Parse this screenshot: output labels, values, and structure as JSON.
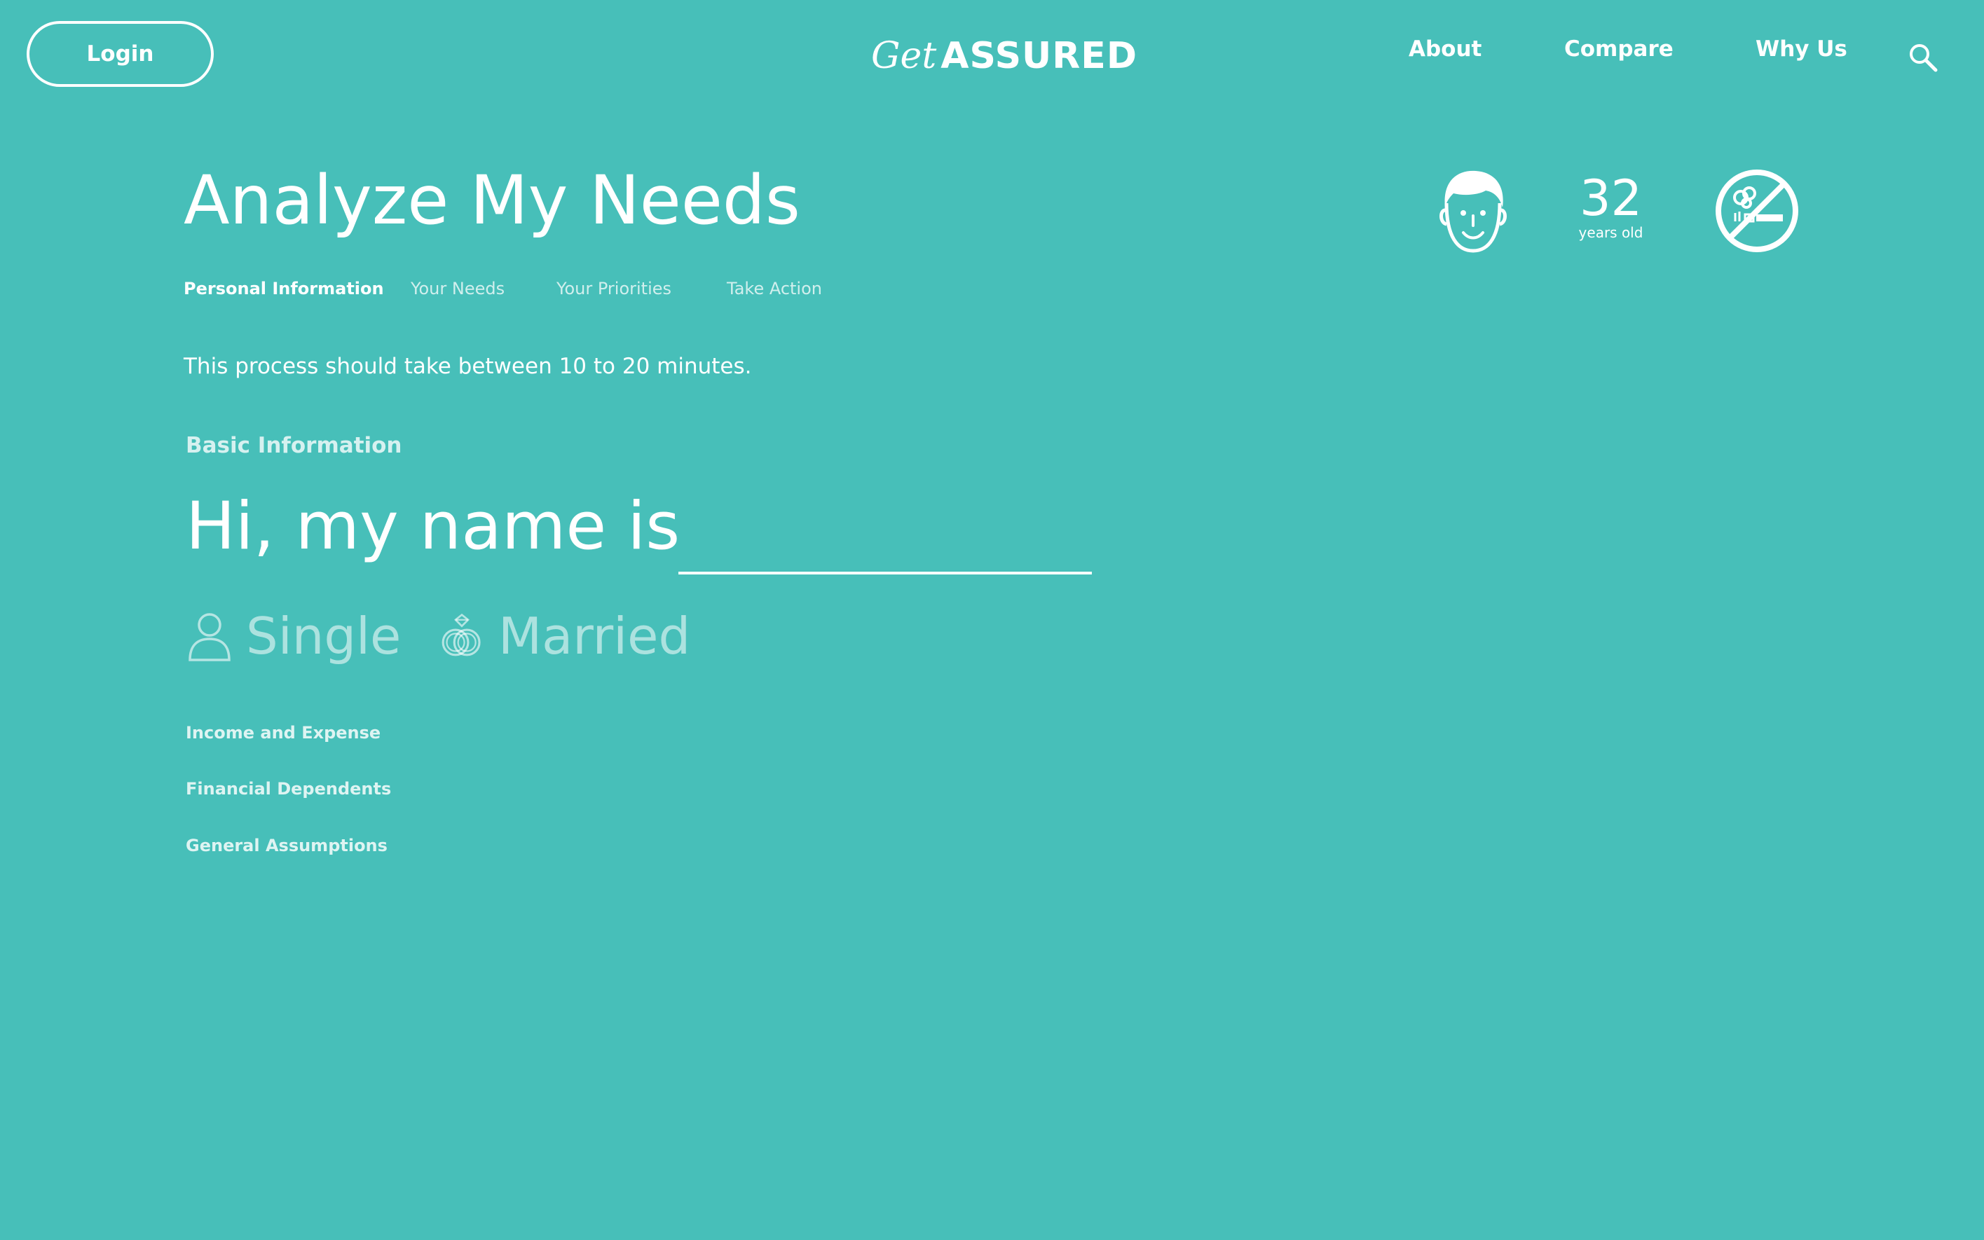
{
  "header": {
    "login_label": "Login",
    "logo_script": "Get",
    "logo_bold": "ASSURED",
    "nav": [
      {
        "label": "About"
      },
      {
        "label": "Compare"
      },
      {
        "label": "Why Us"
      }
    ]
  },
  "main": {
    "title": "Analyze My Needs",
    "steps": [
      {
        "label": "Personal Information",
        "active": true
      },
      {
        "label": "Your Needs",
        "active": false
      },
      {
        "label": "Your Priorities",
        "active": false
      },
      {
        "label": "Take Action",
        "active": false
      }
    ],
    "process_note": "This process should take between 10 to 20 minutes."
  },
  "profile": {
    "age": "32",
    "age_unit": "years old",
    "icons": [
      "face-icon",
      "no-smoking-icon"
    ]
  },
  "basic_info": {
    "section_label": "Basic Information",
    "name_prompt": "Hi, my name is",
    "name_value": "",
    "status_options": [
      {
        "label": "Single",
        "icon": "person-icon"
      },
      {
        "label": "Married",
        "icon": "rings-icon"
      }
    ]
  },
  "subsections": [
    {
      "label": "Income and Expense"
    },
    {
      "label": "Financial Dependents"
    },
    {
      "label": "General Assumptions"
    }
  ],
  "colors": {
    "background": "#47bfb9",
    "foreground": "#ffffff"
  }
}
